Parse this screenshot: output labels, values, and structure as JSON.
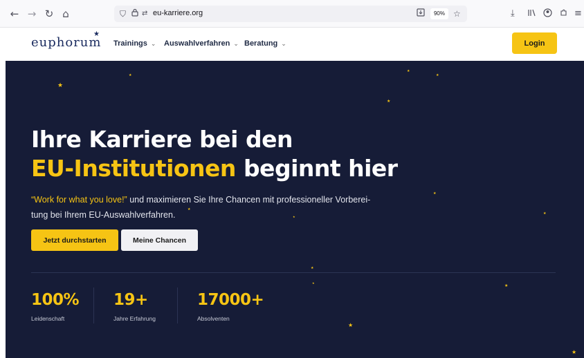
{
  "browser": {
    "url": "eu-karriere.org",
    "zoom": "90%",
    "icons": [
      "back-icon",
      "forward-icon",
      "reload-icon",
      "home-icon",
      "shield-icon",
      "lock-icon",
      "permissions-icon",
      "reader-icon",
      "bookmark-star-icon",
      "download-icon",
      "library-icon",
      "account-icon",
      "extensions-icon",
      "menu-icon"
    ]
  },
  "header": {
    "logo": "euphorum",
    "nav": [
      {
        "label": "Trainings"
      },
      {
        "label": "Auswahlverfahren"
      },
      {
        "label": "Beratung"
      }
    ],
    "login_label": "Login"
  },
  "hero": {
    "headline_line1": "Ihre Karriere bei den",
    "headline_highlight": "EU-Institutionen",
    "headline_rest": "beginnt hier",
    "quote": "“Work for what you love!”",
    "subtext_line1": "und maximieren Sie Ihre Chancen mit professioneller Vorberei-",
    "subtext_line2": "tung bei Ihrem EU-Auswahlverfahren.",
    "cta_primary": "Jetzt durchstarten",
    "cta_secondary": "Meine Chancen",
    "stats": [
      {
        "value": "100%",
        "label": "Leidenschaft"
      },
      {
        "value": "19+",
        "label": "Jahre Erfahrung"
      },
      {
        "value": "17000+",
        "label": "Absolventen"
      }
    ]
  },
  "colors": {
    "accent": "#f6c414",
    "hero_bg": "#161c37",
    "brand": "#1a2b5f"
  }
}
